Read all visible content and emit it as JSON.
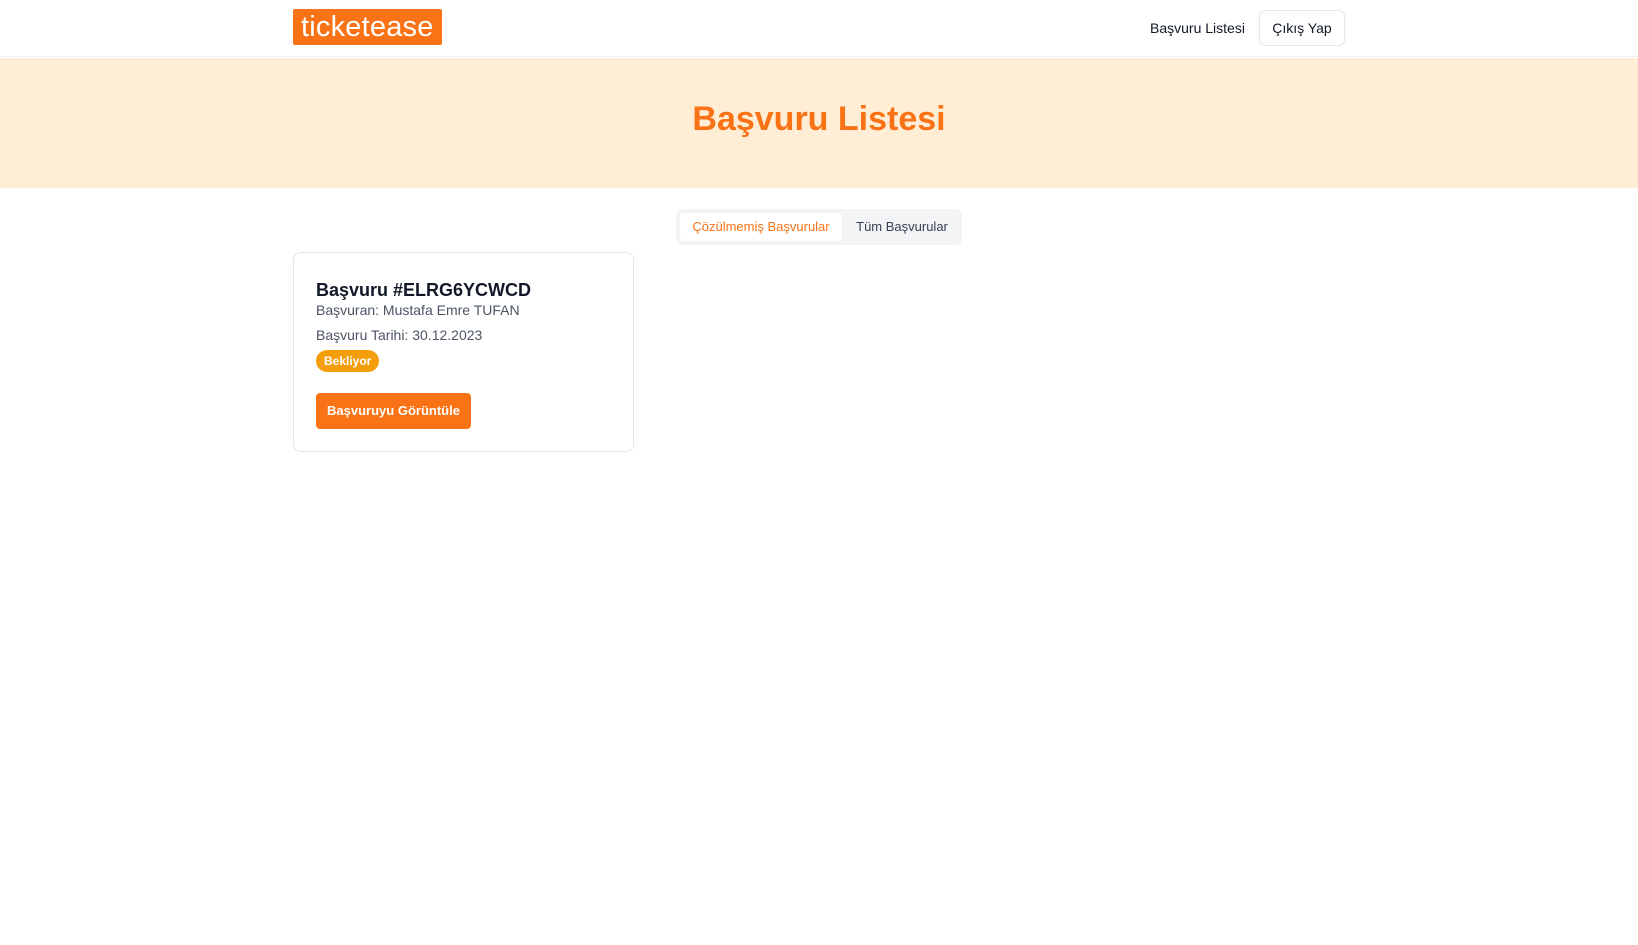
{
  "header": {
    "logo_text": "ticketease",
    "nav_link": "Başvuru Listesi",
    "logout_label": "Çıkış Yap"
  },
  "hero": {
    "title": "Başvuru Listesi"
  },
  "tabs": [
    {
      "label": "Çözülmemiş Başvurular",
      "active": true
    },
    {
      "label": "Tüm Başvurular",
      "active": false
    }
  ],
  "cards": [
    {
      "title": "Başvuru #ELRG6YCWCD",
      "applicant": "Başvuran: Mustafa Emre TUFAN",
      "date": "Başvuru Tarihi: 30.12.2023",
      "status": "Bekliyor",
      "action_label": "Başvuruyu Görüntüle"
    }
  ],
  "colors": {
    "brand": "#f97316",
    "hero_bg": "#ffedd5",
    "status_pending": "#f59e0b"
  }
}
